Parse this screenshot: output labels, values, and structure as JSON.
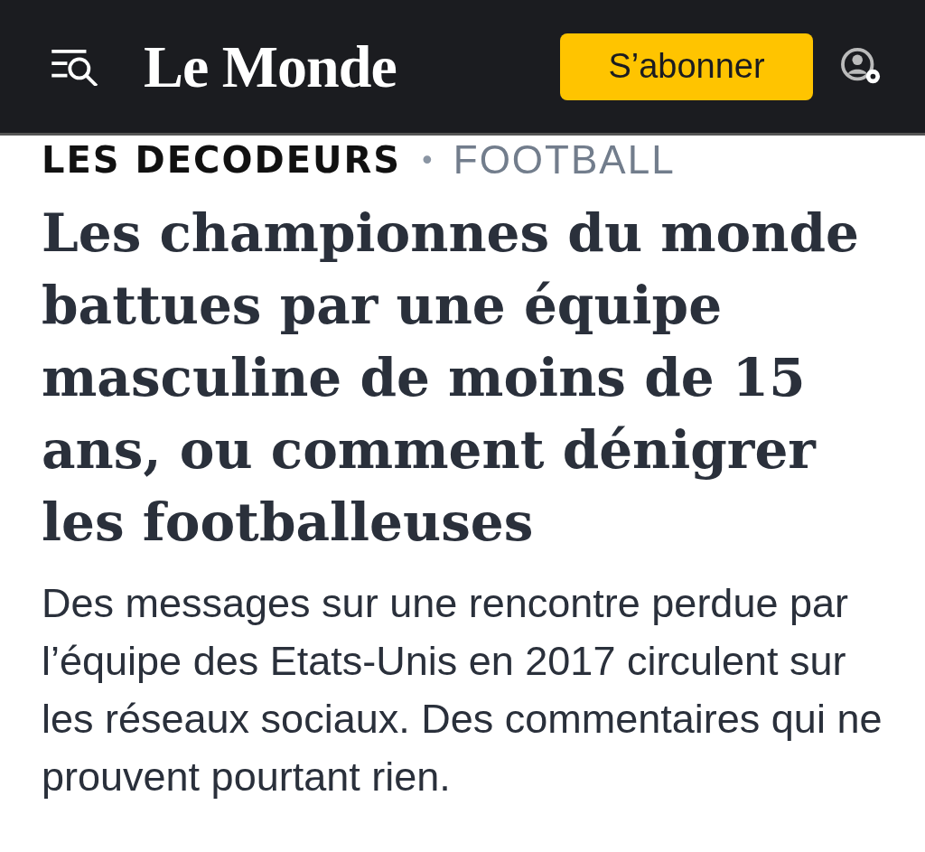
{
  "header": {
    "logo": "Le Monde",
    "subscribe_button": "S’abonner"
  },
  "kicker": {
    "section": "LES DECODEURS",
    "separator": "•",
    "topic": "FOOTBALL"
  },
  "article": {
    "headline": "Les championnes du monde battues par une équipe masculine de moins de 15 ans, ou comment dénigrer les footballeuses",
    "summary": "Des messages sur une rencontre perdue par l’équipe des Etats-Unis en 2017 circulent sur les réseaux sociaux. Des commentaires qui ne prouvent pourtant rien."
  }
}
